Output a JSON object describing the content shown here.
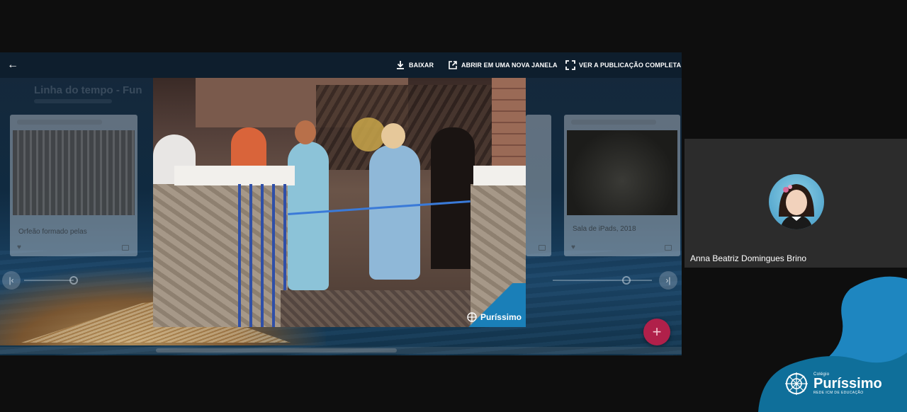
{
  "toolbar": {
    "download_label": "BAIXAR",
    "new_window_label": "ABRIR EM UMA NOVA JANELA",
    "full_publication_label": "VER A PUBLICAÇÃO COMPLETA"
  },
  "timeline": {
    "title": "Linha do tempo - Fun"
  },
  "cards": {
    "left_label": "Orfeão formado pelas",
    "right_label": "Sala de iPads, 2018"
  },
  "photo": {
    "logo_text": "Puríssimo"
  },
  "participant": {
    "name": "Anna Beatriz Domingues Brino"
  },
  "brand": {
    "pre": "Colégio",
    "name": "Puríssimo",
    "sub": "REDE ICM DE EDUCAÇÃO"
  },
  "colors": {
    "fab": "#b0204a",
    "brand_blue": "#1e86c0",
    "brand_teal": "#0f6f9a",
    "tile_bg": "#2c2c2c"
  }
}
